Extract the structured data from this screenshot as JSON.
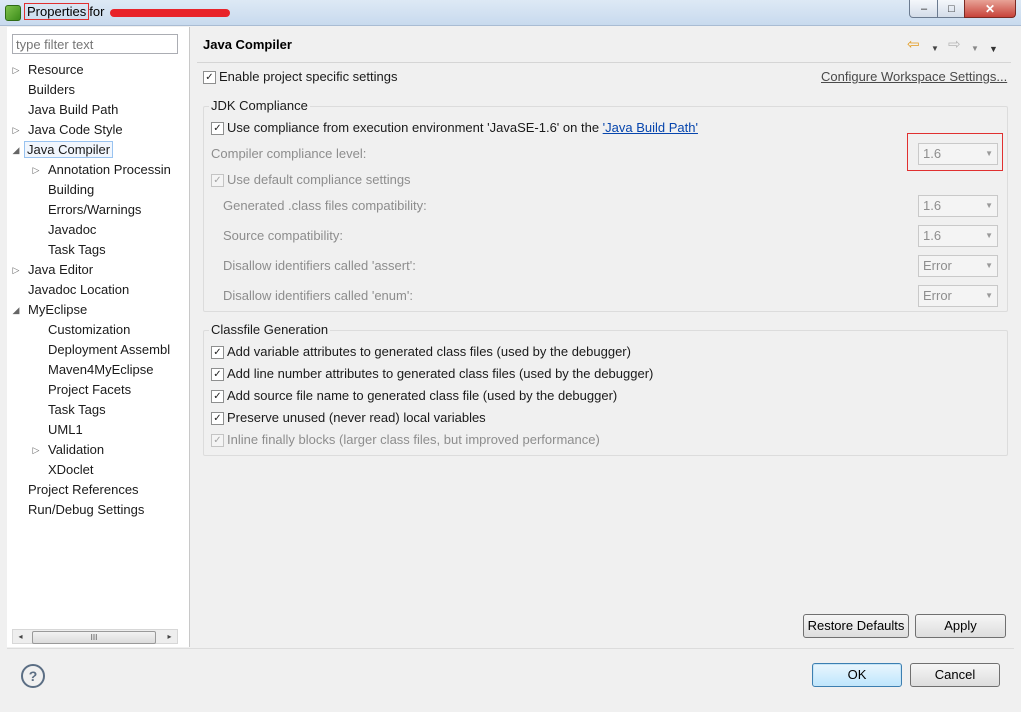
{
  "window": {
    "title_word": "Properties",
    "title_rest": "for ",
    "minimize_glyph": "–",
    "maximize_glyph": "□",
    "close_glyph": "✕"
  },
  "filter": {
    "placeholder": "type filter text"
  },
  "tree": [
    {
      "label": "Resource",
      "level": 0,
      "arrow": "▷"
    },
    {
      "label": "Builders",
      "level": 0,
      "arrow": ""
    },
    {
      "label": "Java Build Path",
      "level": 0,
      "arrow": ""
    },
    {
      "label": "Java Code Style",
      "level": 0,
      "arrow": "▷"
    },
    {
      "label": "Java Compiler",
      "level": 0,
      "arrow": "◢",
      "selected": true
    },
    {
      "label": "Annotation Processin",
      "level": 1,
      "arrow": "▷"
    },
    {
      "label": "Building",
      "level": 1,
      "arrow": ""
    },
    {
      "label": "Errors/Warnings",
      "level": 1,
      "arrow": ""
    },
    {
      "label": "Javadoc",
      "level": 1,
      "arrow": ""
    },
    {
      "label": "Task Tags",
      "level": 1,
      "arrow": ""
    },
    {
      "label": "Java Editor",
      "level": 0,
      "arrow": "▷"
    },
    {
      "label": "Javadoc Location",
      "level": 0,
      "arrow": ""
    },
    {
      "label": "MyEclipse",
      "level": 0,
      "arrow": "◢"
    },
    {
      "label": "Customization",
      "level": 1,
      "arrow": ""
    },
    {
      "label": "Deployment Assembl",
      "level": 1,
      "arrow": ""
    },
    {
      "label": "Maven4MyEclipse",
      "level": 1,
      "arrow": ""
    },
    {
      "label": "Project Facets",
      "level": 1,
      "arrow": ""
    },
    {
      "label": "Task Tags",
      "level": 1,
      "arrow": ""
    },
    {
      "label": "UML1",
      "level": 1,
      "arrow": ""
    },
    {
      "label": "Validation",
      "level": 1,
      "arrow": "▷"
    },
    {
      "label": "XDoclet",
      "level": 1,
      "arrow": ""
    },
    {
      "label": "Project References",
      "level": 0,
      "arrow": ""
    },
    {
      "label": "Run/Debug Settings",
      "level": 0,
      "arrow": ""
    }
  ],
  "scrollbar": {
    "left": "◂",
    "right": "▸",
    "grip": "III"
  },
  "header": {
    "title": "Java Compiler",
    "back_glyph": "⇦",
    "forward_glyph": "⇨",
    "dropdown_glyph": "▼"
  },
  "project_settings": {
    "enable_label": "Enable project specific settings",
    "enable_checked": true,
    "workspace_link": "Configure Workspace Settings..."
  },
  "jdk": {
    "group_title": "JDK Compliance",
    "use_compliance_prefix": "Use compliance from execution environment 'JavaSE-1.6' on the ",
    "use_compliance_link": "'Java Build Path'",
    "use_compliance_checked": true,
    "compliance_level_label": "Compiler compliance level:",
    "compliance_level_value": "1.6",
    "default_settings_label": "Use default compliance settings",
    "default_settings_checked": true,
    "settings": [
      {
        "label": "Generated .class files compatibility:",
        "value": "1.6"
      },
      {
        "label": "Source compatibility:",
        "value": "1.6"
      },
      {
        "label": "Disallow identifiers called 'assert':",
        "value": "Error"
      },
      {
        "label": "Disallow identifiers called 'enum':",
        "value": "Error"
      }
    ]
  },
  "classfile": {
    "group_title": "Classfile Generation",
    "options": [
      {
        "label": "Add variable attributes to generated class files (used by the debugger)",
        "checked": true,
        "disabled": false
      },
      {
        "label": "Add line number attributes to generated class files (used by the debugger)",
        "checked": true,
        "disabled": false
      },
      {
        "label": "Add source file name to generated class file (used by the debugger)",
        "checked": true,
        "disabled": false
      },
      {
        "label": "Preserve unused (never read) local variables",
        "checked": true,
        "disabled": false
      },
      {
        "label": "Inline finally blocks (larger class files, but improved performance)",
        "checked": true,
        "disabled": true
      }
    ]
  },
  "buttons": {
    "restore_defaults": "Restore Defaults",
    "apply": "Apply",
    "ok": "OK",
    "cancel": "Cancel"
  },
  "help_glyph": "?",
  "check_glyph": "✓",
  "combo_arrow_glyph": "▼"
}
